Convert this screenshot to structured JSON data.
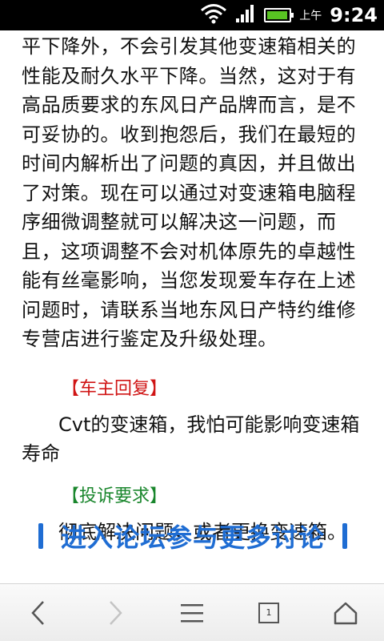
{
  "status_bar": {
    "ampm": "上午",
    "time": "9:24",
    "battery_level": 0.95,
    "colors": {
      "battery": "#58c322"
    },
    "icons": [
      "wifi-icon",
      "signal-icon",
      "battery-icon"
    ]
  },
  "article": {
    "lines": [
      "平下降外，不会引发其他变速箱相关的",
      "性能及耐久水平下降。当然，这对于有",
      "高品质要求的东风日产品牌而言，是不",
      "可妥协的。收到抱怨后，我们在最短的",
      "时间内解析出了问题的真因，并且做出",
      "了对策。现在可以通过对变速箱电脑程",
      "序细微调整就可以解决这一问题，而",
      "且，这项调整不会对机体原先的卓越性",
      "能有丝毫影响，当您发现爱车存在上述",
      "问题时，请联系当地东风日产特约维修",
      "专营店进行鉴定及升级处理。"
    ],
    "owner_reply_title": "【车主回复】",
    "owner_reply_text": "Cvt的变速箱，我怕可能影响变速箱寿命",
    "complaint_title": "【投诉要求】",
    "complaint_text": "彻底解决问题，或者更换变速箱。",
    "forum_banner": "进入论坛参与更多讨论"
  },
  "nav": {
    "tab_count": "1",
    "icons": [
      "back-icon",
      "forward-icon",
      "menu-icon",
      "tabs-icon",
      "home-icon"
    ]
  }
}
